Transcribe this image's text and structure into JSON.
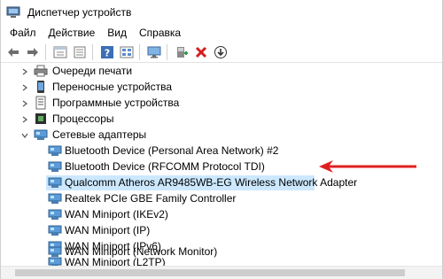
{
  "window": {
    "title": "Диспетчер устройств"
  },
  "menu": {
    "items": [
      "Файл",
      "Действие",
      "Вид",
      "Справка"
    ]
  },
  "toolbar": {
    "buttons": [
      "back-arrow-icon",
      "forward-arrow-icon",
      "properties-icon",
      "list-icon",
      "help-icon",
      "view-icon",
      "monitor-icon",
      "add-driver-icon",
      "delete-icon",
      "download-icon"
    ]
  },
  "tree": {
    "categories": [
      {
        "label": "Очереди печати",
        "expanded": false,
        "icon": "printer-icon"
      },
      {
        "label": "Переносные устройства",
        "expanded": false,
        "icon": "portable-device-icon"
      },
      {
        "label": "Программные устройства",
        "expanded": false,
        "icon": "software-device-icon"
      },
      {
        "label": "Процессоры",
        "expanded": false,
        "icon": "processor-icon"
      },
      {
        "label": "Сетевые адаптеры",
        "expanded": true,
        "icon": "network-adapter-icon"
      }
    ],
    "network_adapters": [
      {
        "label": "Bluetooth Device (Personal Area Network) #2",
        "selected": false
      },
      {
        "label": "Bluetooth Device (RFCOMM Protocol TDI)",
        "selected": false
      },
      {
        "label": "Qualcomm Atheros AR9485WB-EG Wireless Network Adapter",
        "selected": true
      },
      {
        "label": "Realtek PCIe GBE Family Controller",
        "selected": false
      },
      {
        "label": "WAN Miniport (IKEv2)",
        "selected": false
      },
      {
        "label": "WAN Miniport (IP)",
        "selected": false
      },
      {
        "label": "WAN Miniport (IPv6)",
        "selected": false
      },
      {
        "label": "WAN Miniport (L2TP)",
        "selected": false
      },
      {
        "label": "WAN Miniport (Network Monitor)",
        "selected": false
      }
    ]
  },
  "colors": {
    "selection": "#cce8ff",
    "annotation_arrow": "#e02020"
  }
}
